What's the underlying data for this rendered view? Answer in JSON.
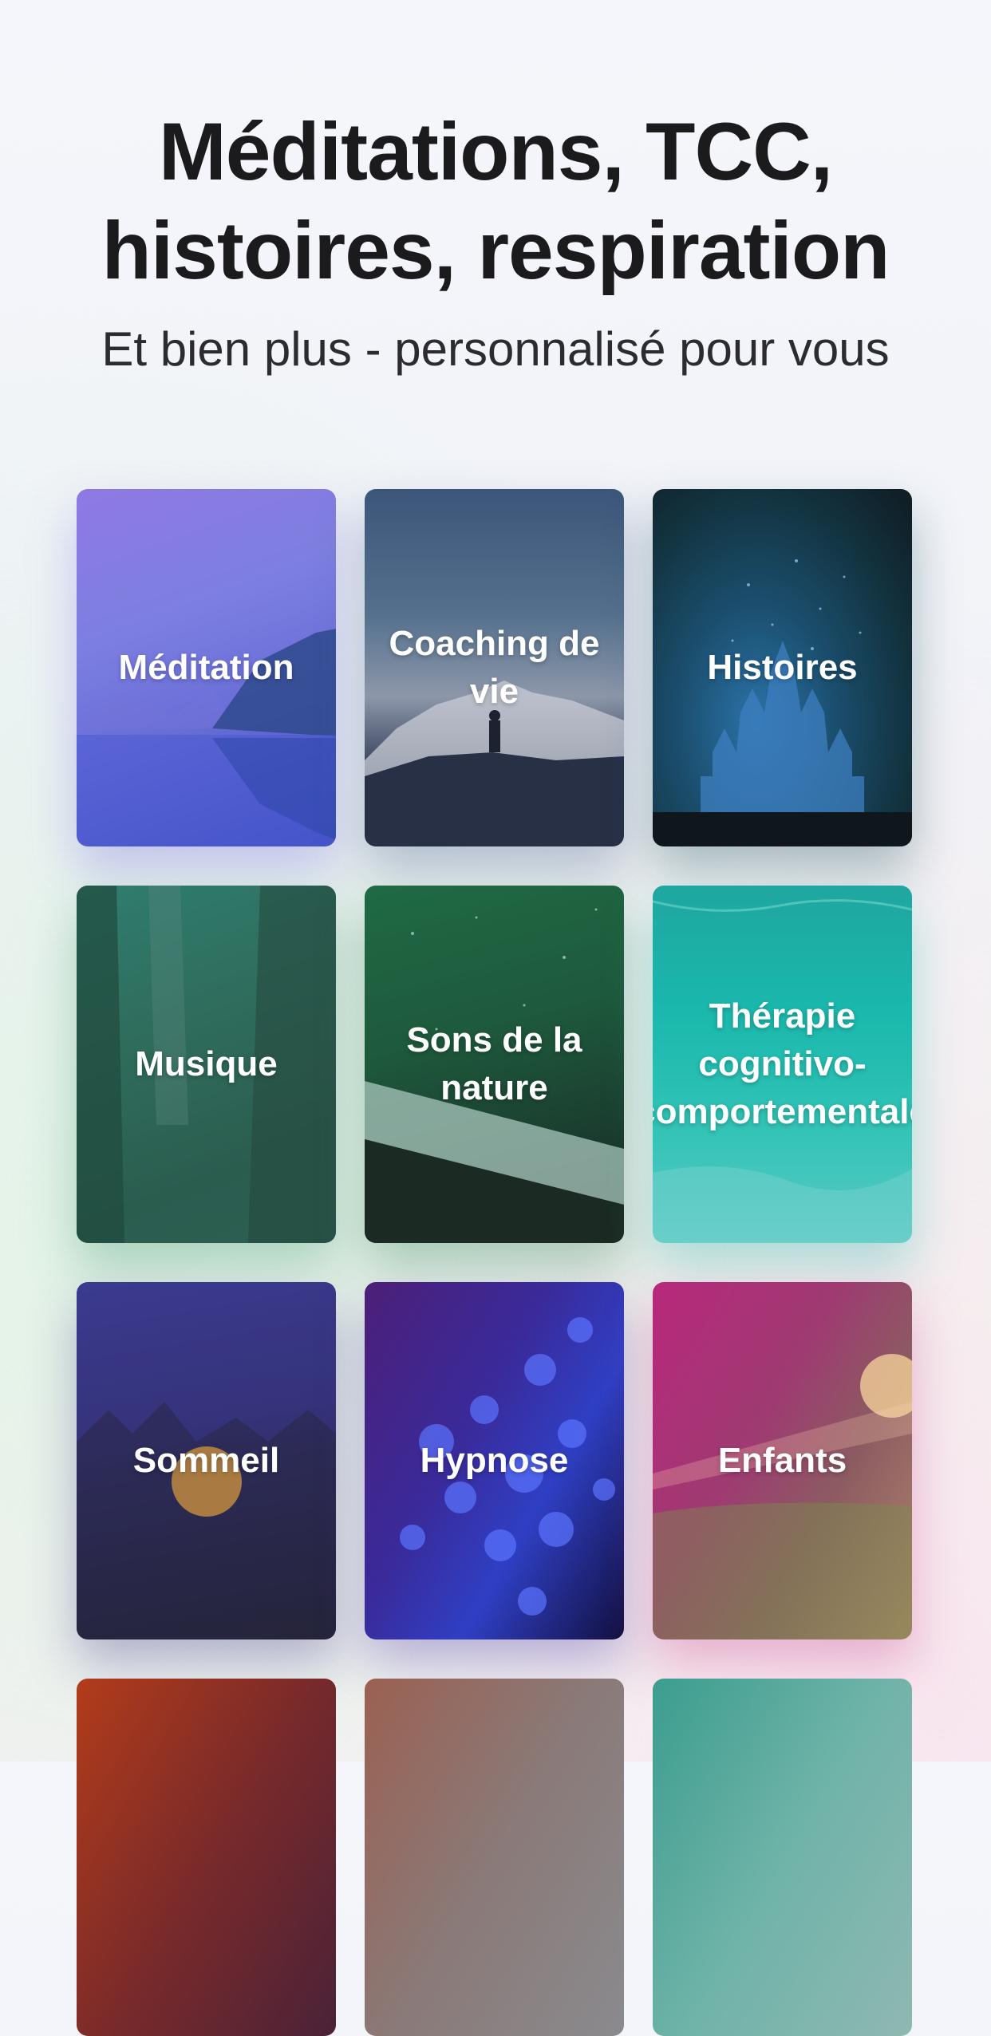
{
  "header": {
    "title_line1": "Méditations, TCC,",
    "title_line2": "histoires, respiration",
    "subtitle": "Et bien plus - personnalisé pour vous"
  },
  "categories": [
    {
      "label": "Méditation",
      "color": "#7d7fe0"
    },
    {
      "label": "Coaching de vie",
      "color": "#54708d"
    },
    {
      "label": "Histoires",
      "color": "#1b4f6f"
    },
    {
      "label": "Musique",
      "color": "#2f6c5c"
    },
    {
      "label": "Sons de la nature",
      "color": "#1e5a3c"
    },
    {
      "label": "Thérapie cognitivo-comportementale",
      "color": "#1ab8ad"
    },
    {
      "label": "Sommeil",
      "color": "#35337a"
    },
    {
      "label": "Hypnose",
      "color": "#3a2a9a"
    },
    {
      "label": "Enfants",
      "color": "#b8287c"
    }
  ]
}
